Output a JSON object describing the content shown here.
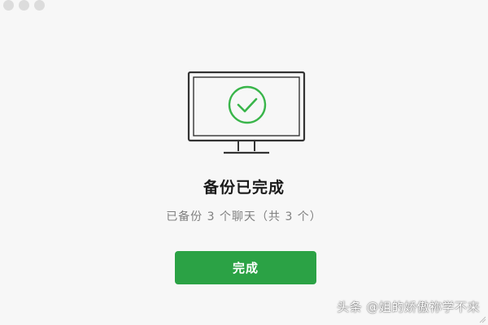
{
  "window": {
    "controls": [
      "close",
      "minimize",
      "maximize"
    ]
  },
  "status": {
    "icon": "monitor-check-icon",
    "title": "备份已完成",
    "subtitle": "已备份 3 个聊天（共 3 个）"
  },
  "actions": {
    "done_label": "完成"
  },
  "watermark": {
    "text": "头条 @姐的娇傲祢学不来"
  },
  "colors": {
    "accent": "#2ba245",
    "check": "#39b54a",
    "title": "#1a1a1a",
    "subtitle": "#808080",
    "background": "#f7f7f7"
  }
}
